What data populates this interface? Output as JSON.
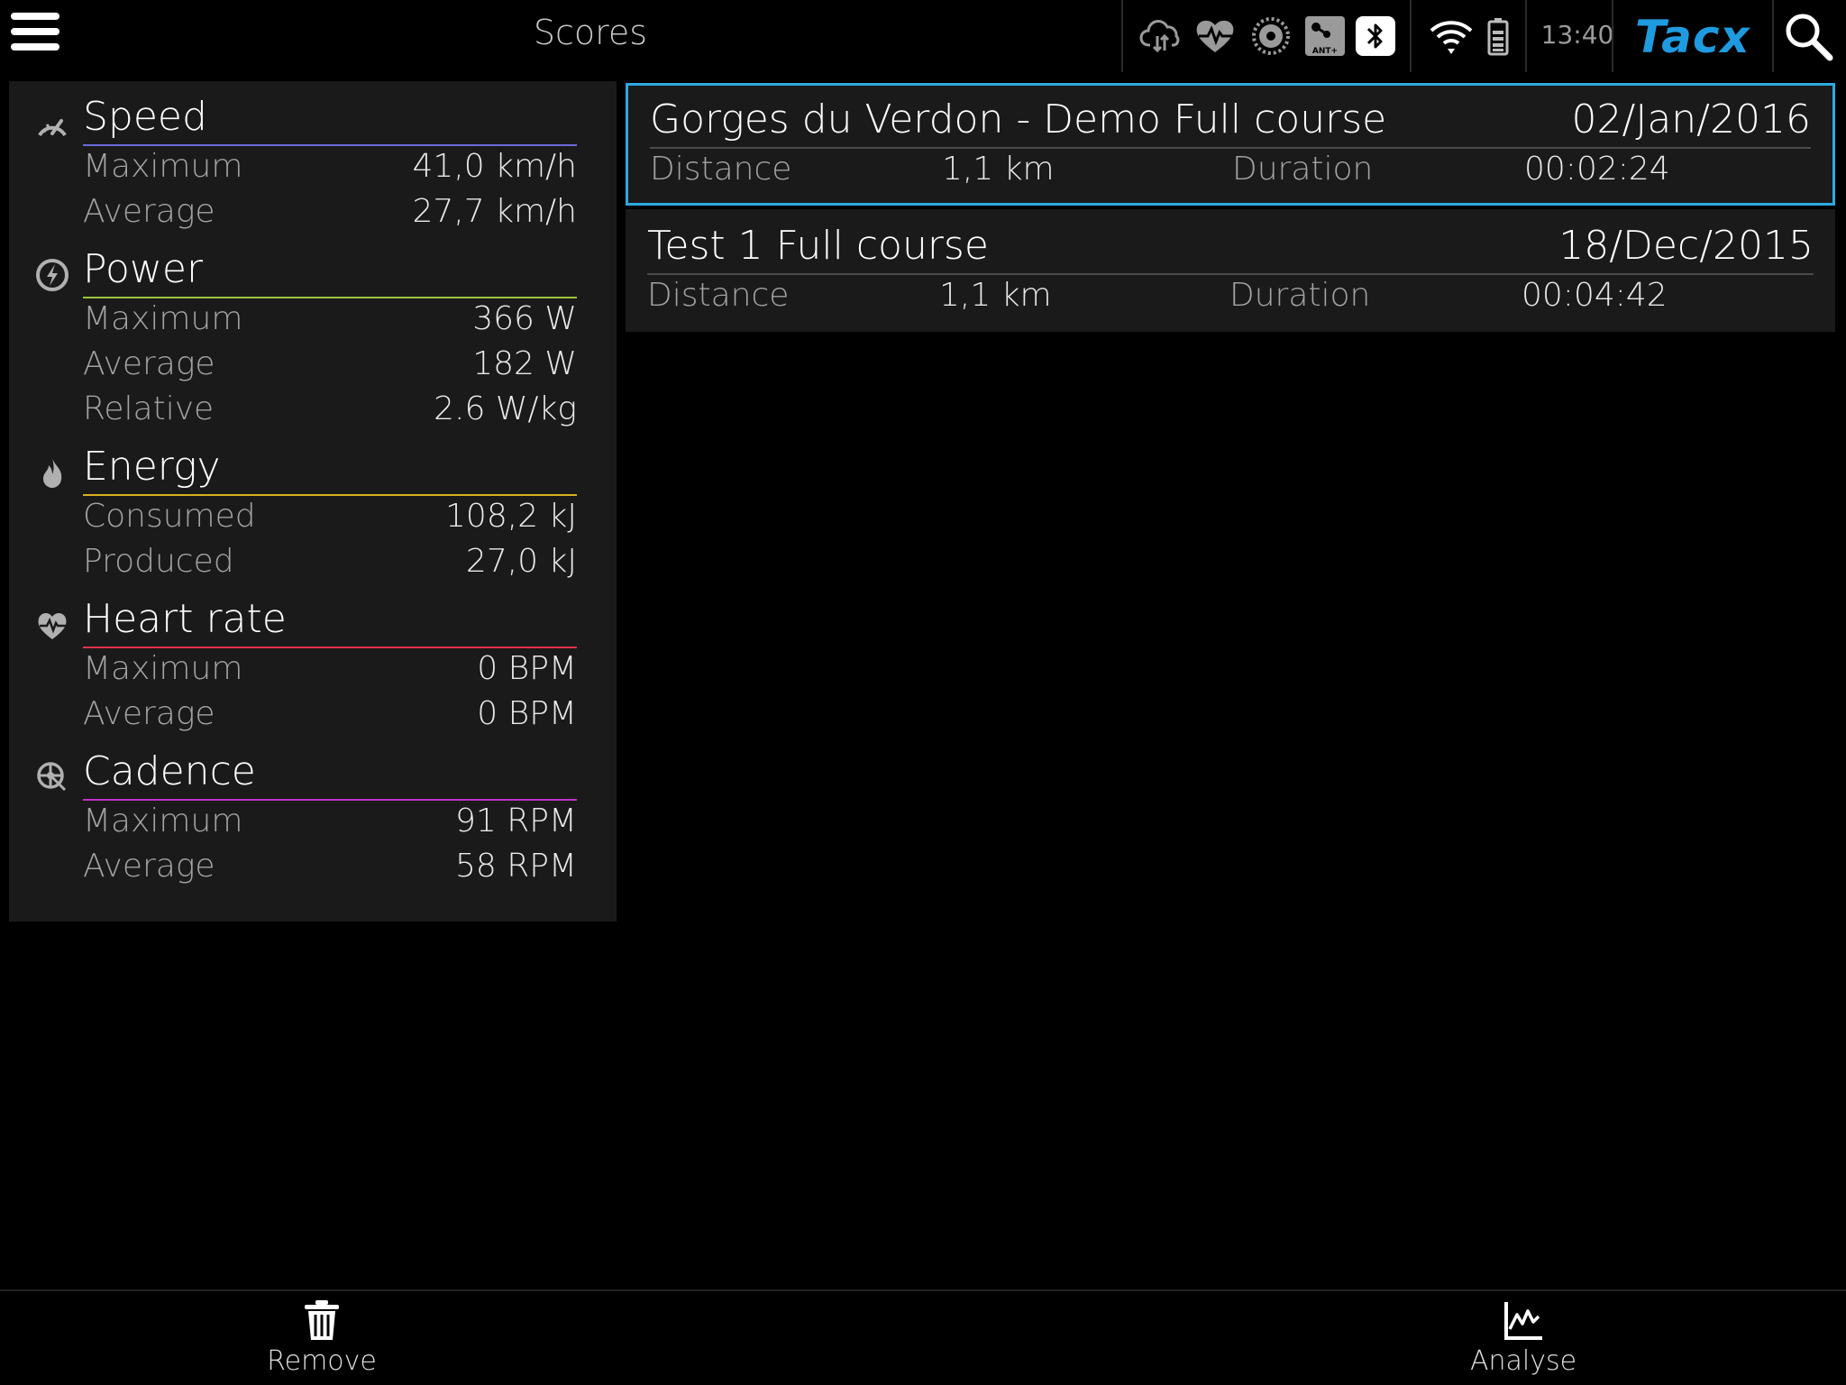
{
  "header": {
    "title": "Scores",
    "time": "13:40",
    "brand": "Tacx",
    "status_icons": [
      "cloud-sync-icon",
      "heart-sensor-icon",
      "cadence-sensor-icon",
      "ant-plus-icon",
      "bluetooth-icon",
      "wifi-icon",
      "battery-icon"
    ],
    "brand_color": "#1e9be0"
  },
  "stats": {
    "speed": {
      "title": "Speed",
      "color": "#6a6ad8",
      "rows": [
        {
          "label": "Maximum",
          "value": "41,0 km/h"
        },
        {
          "label": "Average",
          "value": "27,7 km/h"
        }
      ]
    },
    "power": {
      "title": "Power",
      "color": "#9cc43a",
      "rows": [
        {
          "label": "Maximum",
          "value": "366 W"
        },
        {
          "label": "Average",
          "value": "182 W"
        },
        {
          "label": "Relative",
          "value": "2.6 W/kg"
        }
      ]
    },
    "energy": {
      "title": "Energy",
      "color": "#d8b020",
      "rows": [
        {
          "label": "Consumed",
          "value": "108,2 kJ"
        },
        {
          "label": "Produced",
          "value": "27,0 kJ"
        }
      ]
    },
    "heart_rate": {
      "title": "Heart rate",
      "color": "#e0304a",
      "rows": [
        {
          "label": "Maximum",
          "value": "0 BPM"
        },
        {
          "label": "Average",
          "value": "0 BPM"
        }
      ]
    },
    "cadence": {
      "title": "Cadence",
      "color": "#c030c8",
      "rows": [
        {
          "label": "Maximum",
          "value": "91 RPM"
        },
        {
          "label": "Average",
          "value": "58 RPM"
        }
      ]
    }
  },
  "scores": [
    {
      "name": "Gorges du Verdon - Demo Full course",
      "date": "02/Jan/2016",
      "distance_label": "Distance",
      "distance": "1,1 km",
      "duration_label": "Duration",
      "duration": "00:02:24",
      "selected": true
    },
    {
      "name": "Test 1 Full course",
      "date": "18/Dec/2015",
      "distance_label": "Distance",
      "distance": "1,1 km",
      "duration_label": "Duration",
      "duration": "00:04:42",
      "selected": false
    }
  ],
  "toolbar": {
    "remove_label": "Remove",
    "analyse_label": "Analyse"
  },
  "colors": {
    "selection": "#2fa8e0",
    "panel": "#1a1a1a"
  }
}
